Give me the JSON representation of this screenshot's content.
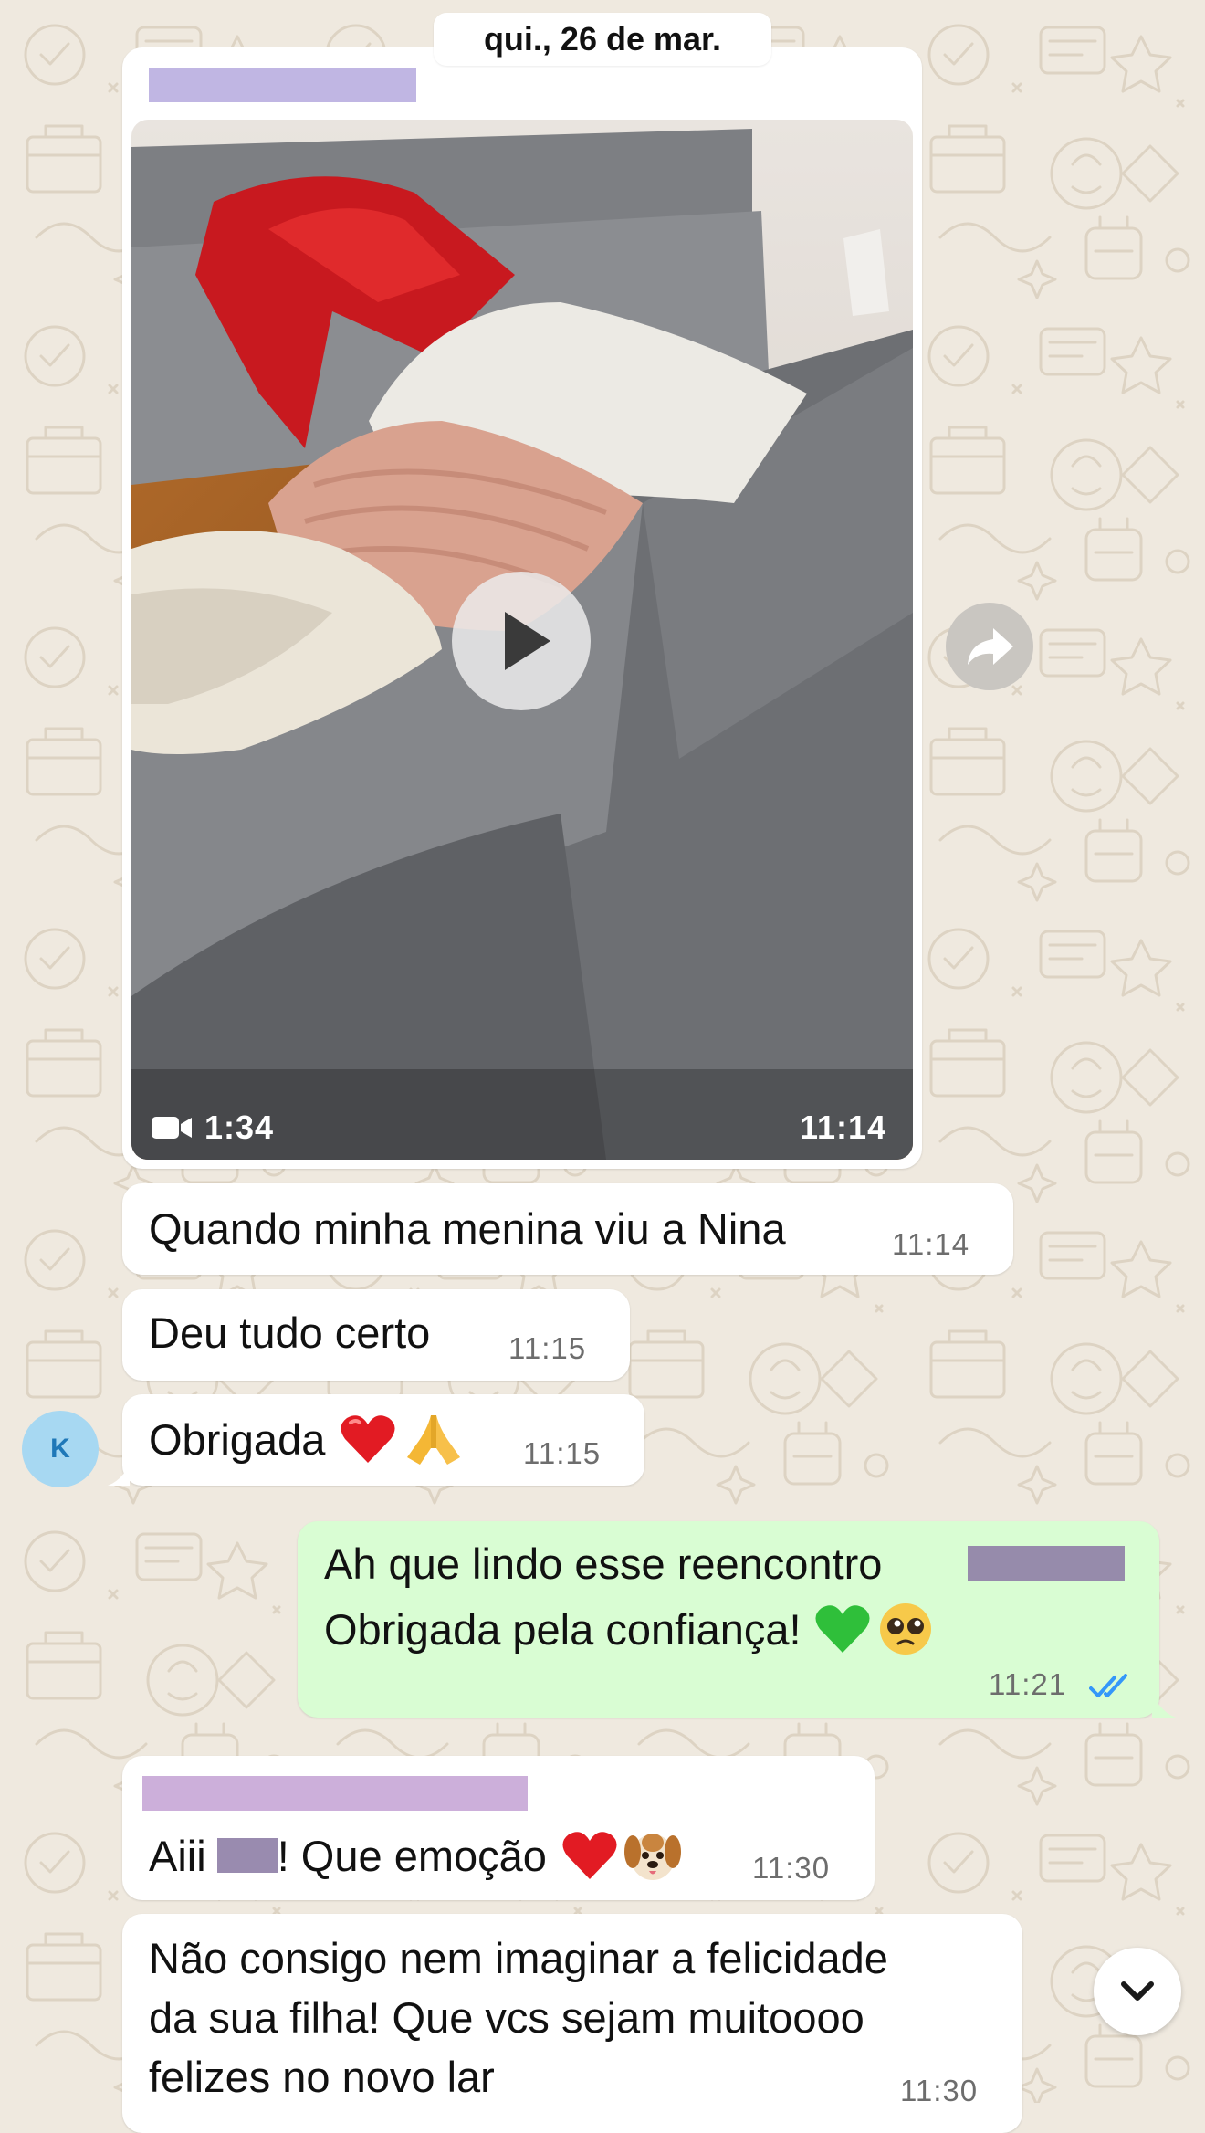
{
  "chat": {
    "date_label": "qui., 26 de mar.",
    "video_message": {
      "duration": "1:34",
      "time": "11:14"
    },
    "messages": [
      {
        "text": "Quando minha menina viu a Nina",
        "time": "11:14"
      },
      {
        "text": "Deu tudo certo",
        "time": "11:15"
      },
      {
        "text": "Obrigada",
        "time": "11:15"
      },
      {
        "line1": "Ah que lindo esse reencontro",
        "line2": "Obrigada pela confiança!",
        "time": "11:21"
      },
      {
        "prefix": "Aiii",
        "suffix": "! Que emoção",
        "time": "11:30"
      },
      {
        "line1": "Não consigo nem imaginar a felicidade",
        "line2": "da sua filha! Que vcs sejam muitoooo",
        "line3": "felizes no novo lar",
        "time": "11:30"
      }
    ],
    "avatar_initial": "K"
  },
  "colors": {
    "wallpaper": "#efe9df",
    "incoming_bubble": "#ffffff",
    "outgoing_bubble": "#d9fdd3",
    "read_ticks": "#3497f9",
    "avatar_bg": "#a7d8f2"
  },
  "icons": {
    "video_camera": "video-camera-icon",
    "play": "play-icon",
    "forward": "forward-icon",
    "read_receipt": "double-check-icon",
    "scroll_down": "chevron-down-icon"
  }
}
